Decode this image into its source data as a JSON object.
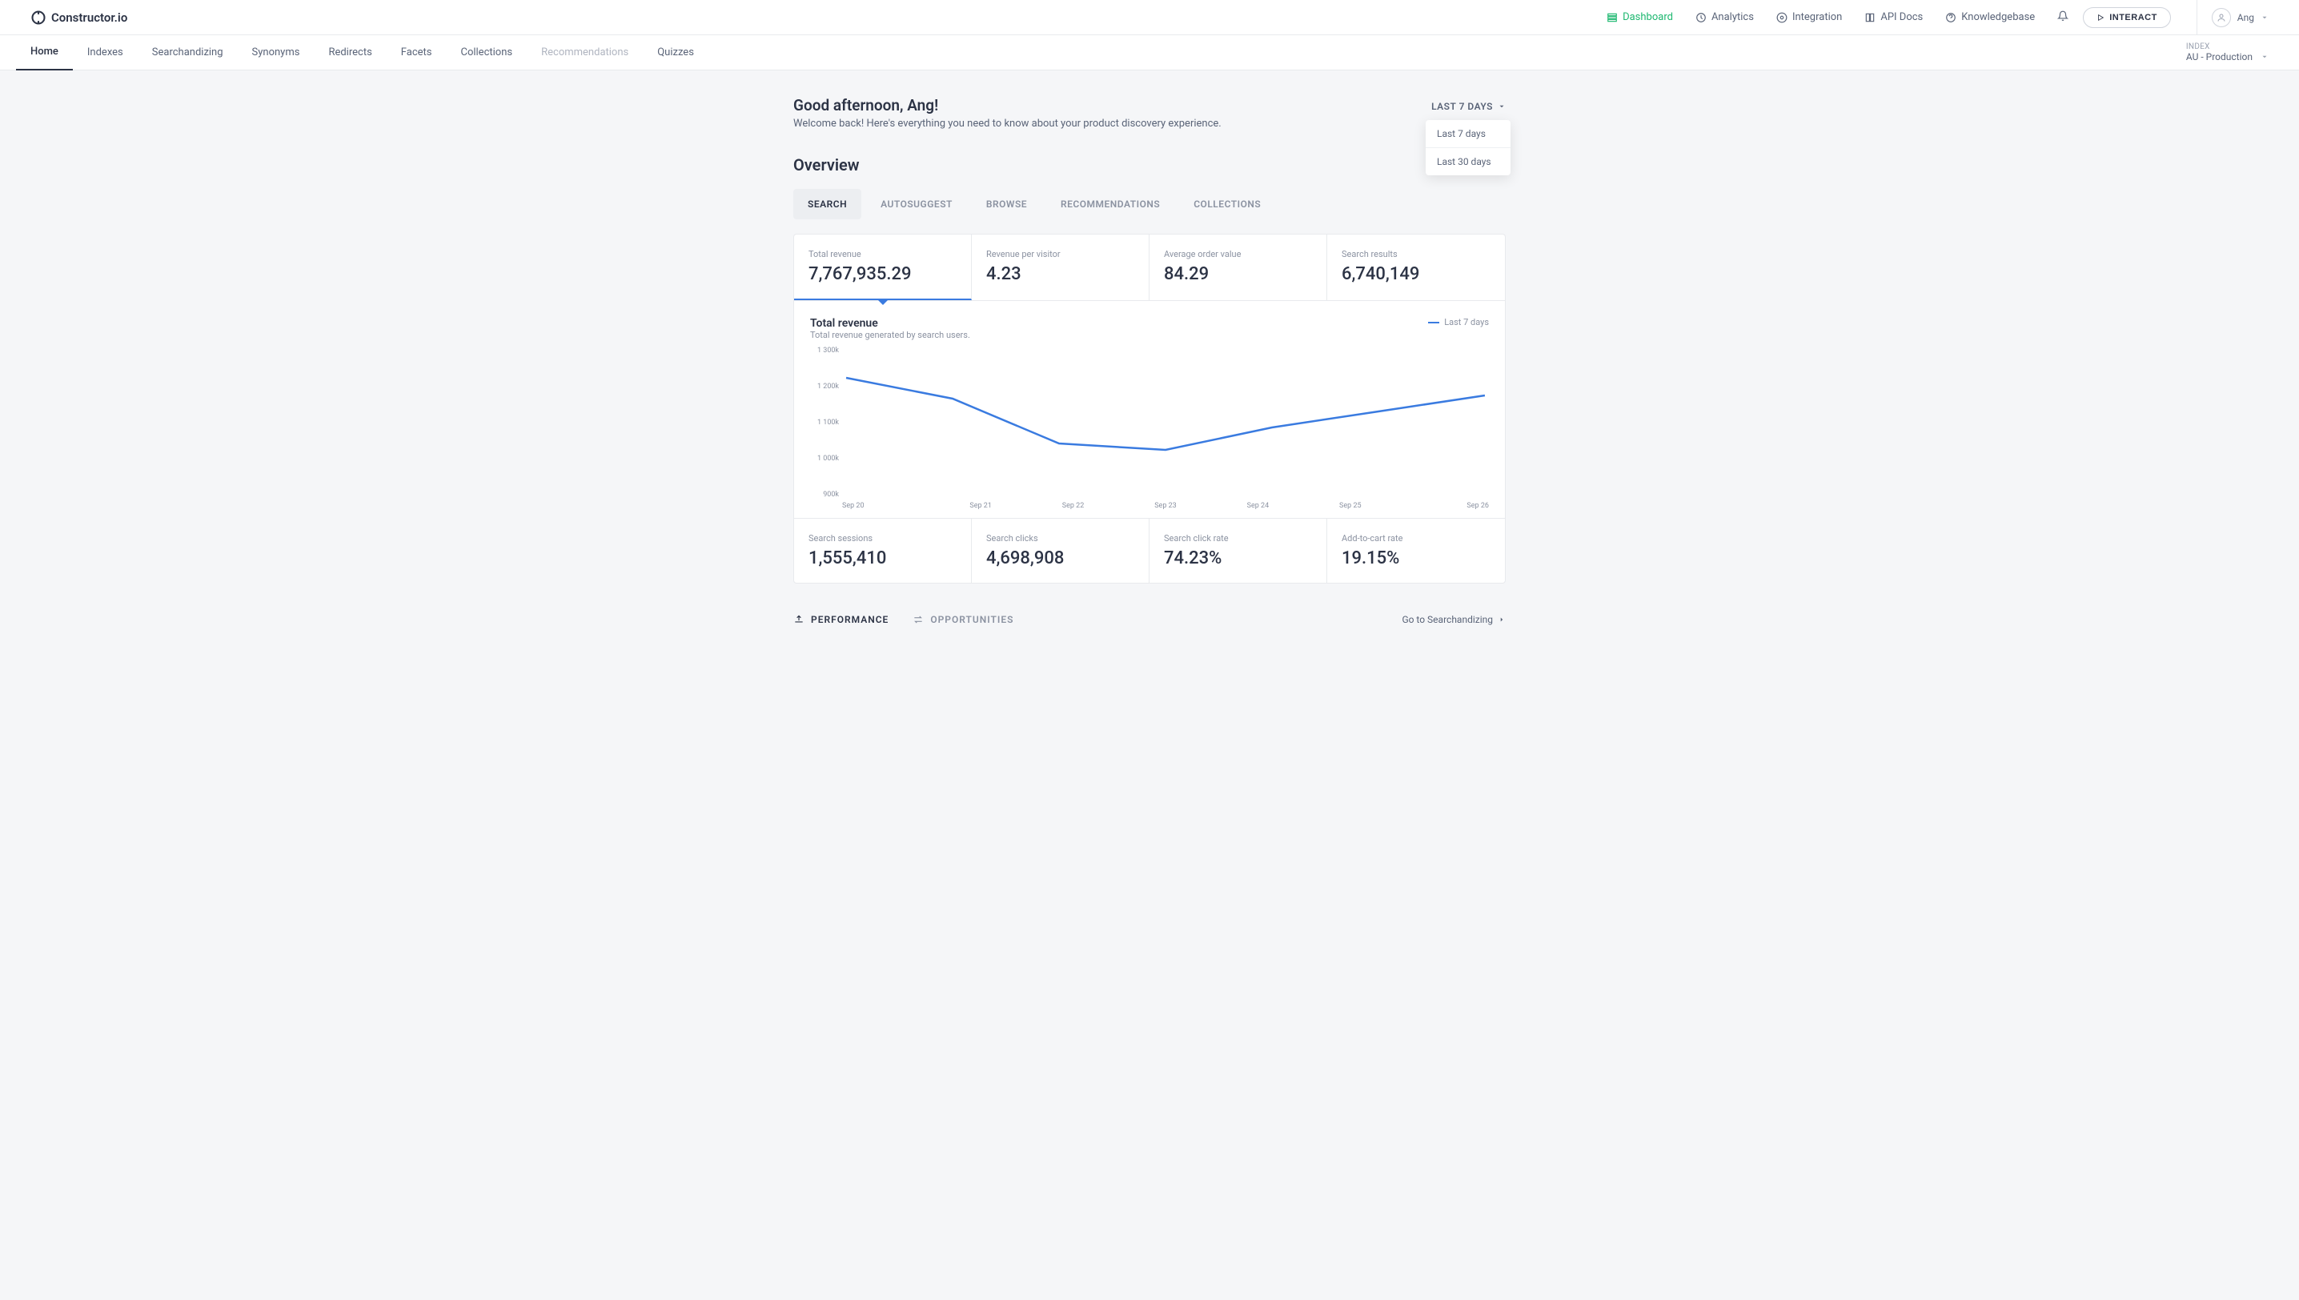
{
  "logo_text": "Constructor.io",
  "top_nav": [
    {
      "label": "Dashboard",
      "active": true
    },
    {
      "label": "Analytics"
    },
    {
      "label": "Integration"
    },
    {
      "label": "API Docs"
    },
    {
      "label": "Knowledgebase"
    }
  ],
  "interact_button": "INTERACT",
  "user_name": "Ang",
  "sub_nav": [
    {
      "label": "Home",
      "active": true
    },
    {
      "label": "Indexes"
    },
    {
      "label": "Searchandizing"
    },
    {
      "label": "Synonyms"
    },
    {
      "label": "Redirects"
    },
    {
      "label": "Facets"
    },
    {
      "label": "Collections"
    },
    {
      "label": "Recommendations",
      "muted": true
    },
    {
      "label": "Quizzes"
    }
  ],
  "index_label": "INDEX",
  "index_value": "AU - Production",
  "greeting_title": "Good afternoon, Ang!",
  "greeting_sub": "Welcome back! Here's everything you need to know about your product discovery experience.",
  "date_filter_label": "LAST 7 DAYS",
  "date_filter_options": [
    "Last 7 days",
    "Last 30 days"
  ],
  "overview_title": "Overview",
  "overview_tabs": [
    "SEARCH",
    "AUTOSUGGEST",
    "BROWSE",
    "RECOMMENDATIONS",
    "COLLECTIONS"
  ],
  "metrics_top": [
    {
      "label": "Total revenue",
      "value": "7,767,935.29"
    },
    {
      "label": "Revenue per visitor",
      "value": "4.23"
    },
    {
      "label": "Average order value",
      "value": "84.29"
    },
    {
      "label": "Search results",
      "value": "6,740,149"
    }
  ],
  "chart_title": "Total revenue",
  "chart_sub": "Total revenue generated by search users.",
  "chart_legend": "Last 7 days",
  "metrics_bottom": [
    {
      "label": "Search sessions",
      "value": "1,555,410"
    },
    {
      "label": "Search clicks",
      "value": "4,698,908"
    },
    {
      "label": "Search click rate",
      "value": "74.23%"
    },
    {
      "label": "Add-to-cart rate",
      "value": "19.15%"
    }
  ],
  "perf_tabs": [
    {
      "label": "PERFORMANCE",
      "active": true
    },
    {
      "label": "OPPORTUNITIES"
    }
  ],
  "goto_link": "Go to Searchandizing",
  "chart_data": {
    "type": "line",
    "title": "Total revenue",
    "xlabel": "",
    "ylabel": "",
    "ylim": [
      900000,
      1300000
    ],
    "y_ticks": [
      "1 300k",
      "1 200k",
      "1 100k",
      "1 000k",
      "900k"
    ],
    "categories": [
      "Sep 20",
      "Sep 21",
      "Sep 22",
      "Sep 23",
      "Sep 24",
      "Sep 25",
      "Sep 26"
    ],
    "series": [
      {
        "name": "Last 7 days",
        "values": [
          1215000,
          1150000,
          1010000,
          990000,
          1060000,
          1110000,
          1160000
        ]
      }
    ]
  }
}
